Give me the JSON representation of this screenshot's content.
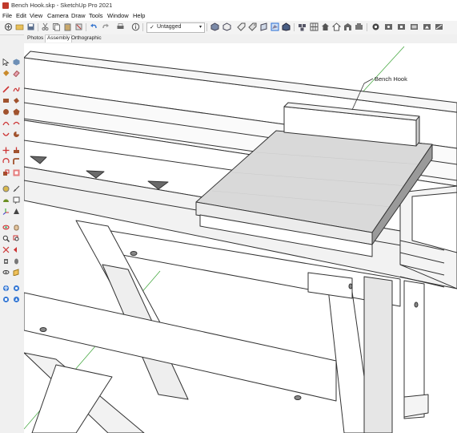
{
  "window": {
    "title": "Bench Hook.skp - SketchUp Pro 2021"
  },
  "menu": [
    "File",
    "Edit",
    "View",
    "Camera",
    "Draw",
    "Tools",
    "Window",
    "Help"
  ],
  "toolbar": {
    "tag_dropdown": {
      "value": "Untagged",
      "check": "✓",
      "arrow": "▾"
    }
  },
  "scene_tabs": [
    {
      "label": "Photos",
      "active": false
    },
    {
      "label": "Assembly",
      "active": true
    },
    {
      "label": "Orthographic",
      "active": false
    }
  ],
  "viewport": {
    "label": "Bench Hook"
  },
  "colors": {
    "accent": "#2b6fd6",
    "axis_green": "#3aa335",
    "edge": "#333333",
    "board": "#d9d9d9"
  }
}
